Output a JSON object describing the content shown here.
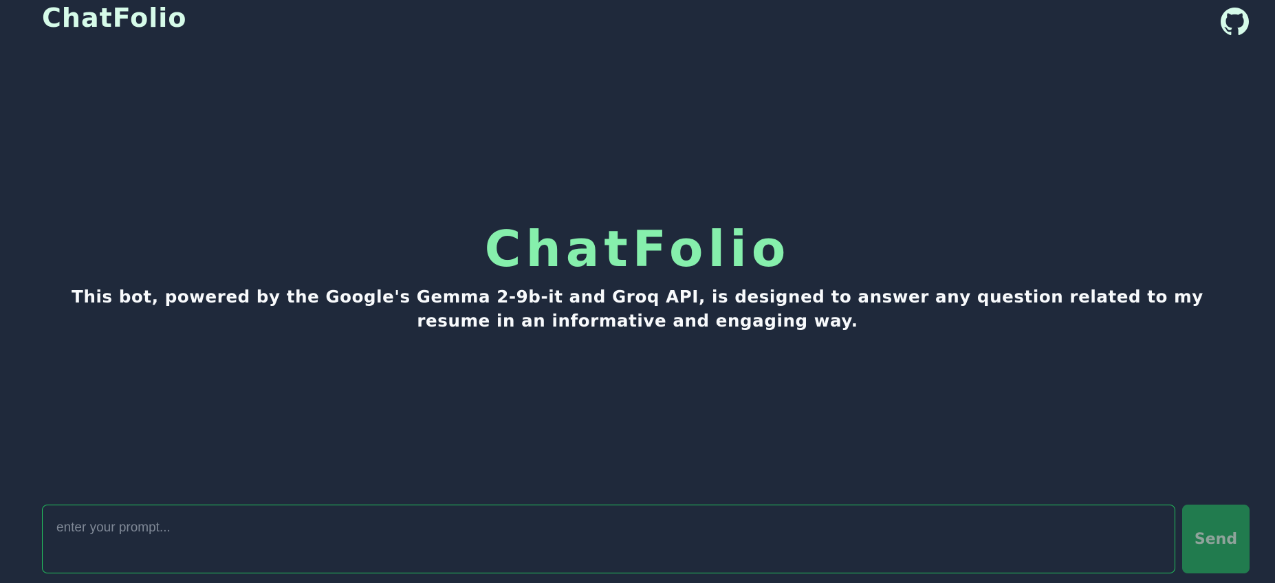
{
  "header": {
    "brand": "ChatFolio",
    "github_icon": "github-icon"
  },
  "hero": {
    "title": "ChatFolio",
    "subtitle": "This bot, powered by the Google's Gemma 2-9b-it and Groq API, is designed to answer any question related to my resume in an informative and engaging way."
  },
  "prompt": {
    "value": "",
    "placeholder": "enter your prompt...",
    "send_label": "Send"
  },
  "colors": {
    "background": "#1f293b",
    "accent": "#86efac",
    "brand": "#d6fbe9",
    "input_border": "#22c55e",
    "send_button": "#217b4e"
  }
}
